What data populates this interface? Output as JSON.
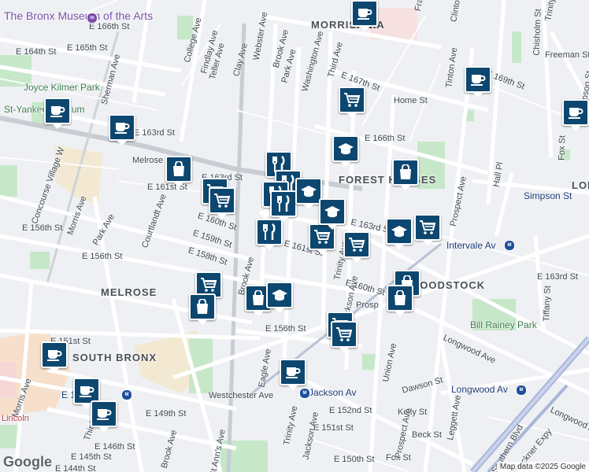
{
  "map": {
    "neighborhoods": [
      "MORRISANIA",
      "FOREST HOUSES",
      "MELROSE",
      "SOUTH BRONX",
      "WOODSTOCK",
      "LONGWOOD"
    ],
    "poi": {
      "museum": "The Bronx Museum of the Arts",
      "park": "Joyce Kilmer Park",
      "yankee": "St-Yankee Stadium",
      "hospital": "Lincoln",
      "bill": "Bill Rainey Park"
    },
    "streets": {
      "s1": "E 166th St",
      "s2": "E 165th St",
      "s3": "E 164th St",
      "s4": "E 163rd St",
      "s5": "Melrose Ave",
      "s6": "E 161st St",
      "s7": "College Ave",
      "s8": "Findlay Ave",
      "s9": "Teller Ave",
      "s10": "Clay Ave",
      "s11": "Webster Ave",
      "s12": "Brook Ave",
      "s13": "Park Ave",
      "s14": "Washington Ave",
      "s15": "Third Ave",
      "s16": "E 167th St",
      "s17": "Home St",
      "s18": "E 166th St",
      "s19": "E 163rd St",
      "s20": "E 160th St",
      "s21": "E 159th St",
      "s22": "E 158th St",
      "s23": "E 156th St",
      "s24": "E 156th St",
      "s25": "Morris Ave",
      "s26": "Park Ave",
      "s27": "Courtlandt Ave",
      "s28": "Concourse Village W",
      "s29": "Sherman Ave",
      "s30": "E 151st St",
      "s31": "Westchester Ave",
      "s32": "Jackson Av",
      "s33": "E 152nd St",
      "s34": "E 151st St",
      "s35": "Kelly St",
      "s36": "Beck St",
      "s37": "Fox St",
      "s38": "E 150th St",
      "s39": "E 149th St",
      "s40": "E 146th St",
      "s41": "E 145th St",
      "s42": "E 144th St",
      "s43": "Brook Ave",
      "s44": "Trinity Ave",
      "s45": "Jackson Ave",
      "s46": "Eagle Ave",
      "s47": "Prospect Ave",
      "s48": "Union Ave",
      "s49": "Dawson St",
      "s50": "Longwood Ave",
      "s51": "Southern Blvd",
      "s52": "Tiffany St",
      "s53": "Intervale Av",
      "s54": "Simpson St",
      "s55": "Hall Pl",
      "s56": "Fox St",
      "s57": "Chisholm St",
      "s58": "Freeman St",
      "s59": "Tinton Ave",
      "s60": "E 169th St",
      "s61": "E 163rd St",
      "s62": "Longwood Av",
      "s63": "Leggett Ave",
      "s64": "Bruckner Expy",
      "s65": "Longwood Ave",
      "s66": "Morris Ave",
      "s67": "Third Ave",
      "s68": "E 149 St",
      "s69": "Clinton",
      "s70": "Prospect Ave",
      "s71": "St Ann's Ave",
      "s72": "Prosp",
      "s73": "E 156th St",
      "s74": "Brook Ave",
      "s75": "E 160th St",
      "s76": "Fra",
      "s77": "E 161st St",
      "s78": "Trinity Ave",
      "s79": "Jackson Ave",
      "s80": "E 163rd St",
      "s81": "Simpson St",
      "s82": "Trinity"
    },
    "attribution": "Map data ©2025 Google",
    "logo": "Google"
  },
  "pins": [
    {
      "type": "coffee"
    },
    {
      "type": "coffee"
    },
    {
      "type": "coffee"
    },
    {
      "type": "coffee"
    },
    {
      "type": "coffee"
    },
    {
      "type": "coffee"
    },
    {
      "type": "coffee"
    },
    {
      "type": "coffee"
    },
    {
      "type": "coffee"
    },
    {
      "type": "grocery"
    },
    {
      "type": "grocery"
    },
    {
      "type": "grocery"
    },
    {
      "type": "grocery"
    },
    {
      "type": "grocery"
    },
    {
      "type": "grocery"
    },
    {
      "type": "grocery"
    },
    {
      "type": "grocery"
    },
    {
      "type": "grocery"
    },
    {
      "type": "shopping"
    },
    {
      "type": "shopping"
    },
    {
      "type": "shopping"
    },
    {
      "type": "shopping"
    },
    {
      "type": "shopping"
    },
    {
      "type": "shopping"
    },
    {
      "type": "restaurant"
    },
    {
      "type": "restaurant"
    },
    {
      "type": "restaurant"
    },
    {
      "type": "restaurant"
    },
    {
      "type": "restaurant"
    },
    {
      "type": "school"
    },
    {
      "type": "school"
    },
    {
      "type": "school"
    },
    {
      "type": "school"
    },
    {
      "type": "school"
    }
  ],
  "colors": {
    "pin": "#0d4770",
    "park": "#c6e8c9",
    "metro": "#1d4f9c",
    "highway": "#a9b6d8"
  }
}
